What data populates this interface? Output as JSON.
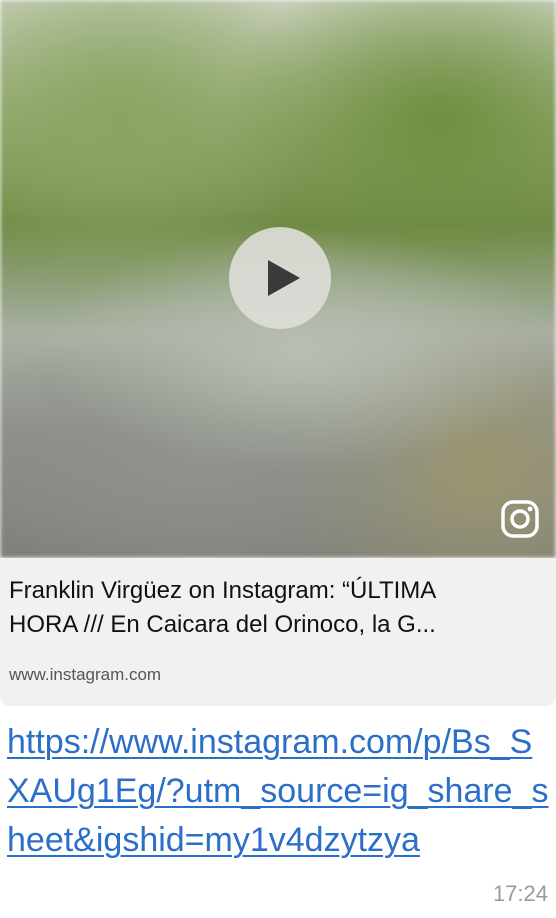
{
  "preview": {
    "title": "Franklin Virgüez on Instagram: “ÚLTIMA\nHORA /// En  Caicara del Orinoco, la G...",
    "domain": "www.instagram.com",
    "play_icon": "play-icon",
    "platform_icon": "instagram-icon"
  },
  "message": {
    "link": "https://www.instagram.com/p/Bs_SXAUg1Eg/?utm_source=ig_share_sheet&igshid=my1v4dzytzya",
    "time": "17:24"
  },
  "colors": {
    "link": "#2b6fc6",
    "preview_bg": "#f1f1f2",
    "timestamp": "#9a9a9a"
  }
}
